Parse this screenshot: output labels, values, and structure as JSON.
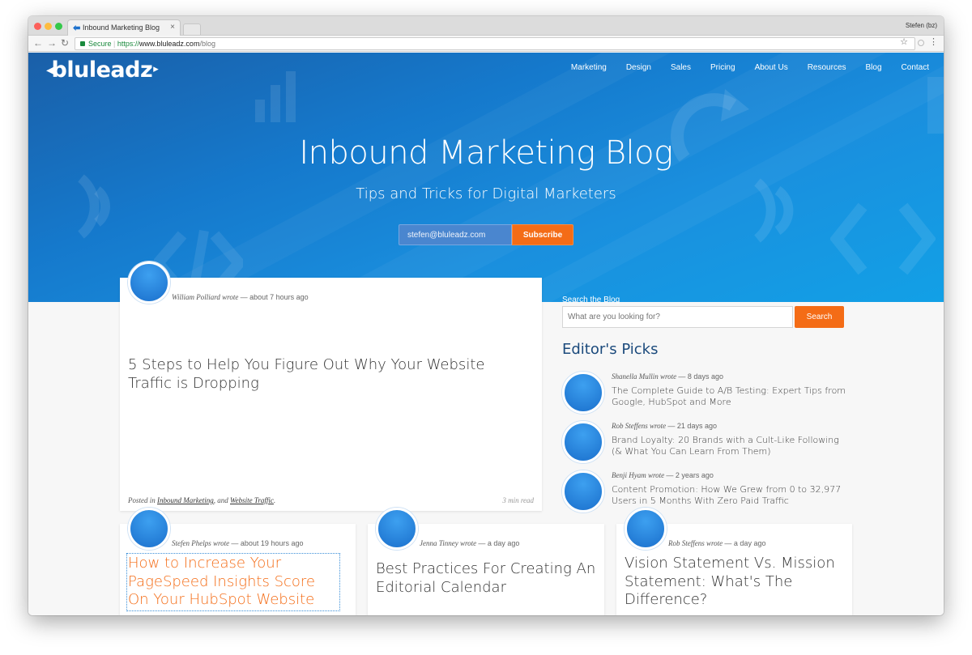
{
  "browser": {
    "tab_title": "Inbound Marketing Blog",
    "tab_close": "×",
    "profile": "Stefen (bz)",
    "secure_label": "Secure",
    "url_scheme": "https://",
    "url_host": "www.bluleadz.com",
    "url_path": "/blog",
    "back_glyph": "←",
    "forward_glyph": "→",
    "reload_glyph": "↻",
    "star_glyph": "☆",
    "menu_glyph": "⋮"
  },
  "site": {
    "logo": "bluleadz",
    "nav": [
      "Marketing",
      "Design",
      "Sales",
      "Pricing",
      "About Us",
      "Resources",
      "Blog",
      "Contact"
    ]
  },
  "hero": {
    "title": "Inbound Marketing Blog",
    "subtitle": "Tips and Tricks for Digital Marketers",
    "email_value": "stefen@bluleadz.com",
    "subscribe_label": "Subscribe"
  },
  "featured": {
    "author": "William Polliard wrote",
    "time": "— about 7 hours ago",
    "title": "5 Steps to Help You Figure Out Why Your Website Traffic is Dropping",
    "posted_prefix": "Posted in",
    "tag1": "Inbound Marketing",
    "tag_sep": ", and",
    "tag2": "Website Traffic",
    "tag_end": ".",
    "read_time": "3 min read"
  },
  "sidebar": {
    "search_label": "Search the Blog",
    "search_placeholder": "What are you looking for?",
    "search_button": "Search",
    "picks_heading": "Editor's Picks",
    "picks": [
      {
        "author": "Shanella Mullin wrote",
        "time": "— 8 days ago",
        "title": "The Complete Guide to A/B Testing: Expert Tips from Google, HubSpot and More"
      },
      {
        "author": "Rob Steffens wrote",
        "time": "— 21 days ago",
        "title": "Brand Loyalty: 20 Brands with a Cult-Like Following (& What You Can Learn From Them)"
      },
      {
        "author": "Benji Hyam wrote",
        "time": "— 2 years ago",
        "title": "Content Promotion: How We Grew from 0 to 32,977 Users in 5 Months With Zero Paid Traffic"
      }
    ]
  },
  "posts": [
    {
      "author": "Stefen Phelps wrote",
      "time": "— about 19 hours ago",
      "title": "How to Increase Your PageSpeed Insights Score On Your HubSpot Website"
    },
    {
      "author": "Jenna Tinney wrote",
      "time": "— a day ago",
      "title": "Best Practices For Creating An Editorial Calendar"
    },
    {
      "author": "Rob Steffens wrote",
      "time": "— a day ago",
      "title": "Vision Statement Vs. Mission Statement: What's The Difference?"
    }
  ],
  "colors": {
    "accent_orange": "#f46c16",
    "hero_blue": "#1579cc",
    "heading_navy": "#1b4a7c"
  }
}
